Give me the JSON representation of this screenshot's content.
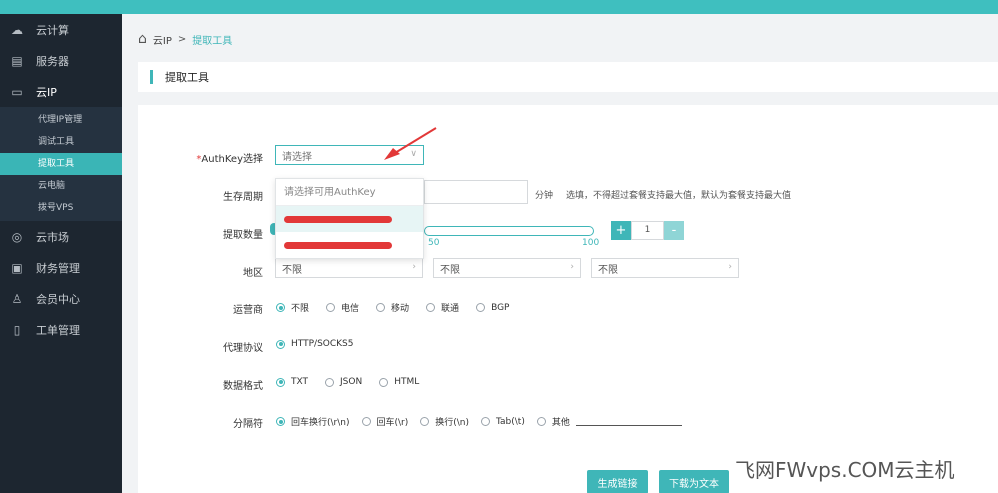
{
  "sidebar": {
    "items": [
      {
        "icon": "cloud-icon",
        "label": "云计算"
      },
      {
        "icon": "server-icon",
        "label": "服务器"
      },
      {
        "icon": "monitor-icon",
        "label": "云IP"
      }
    ],
    "sub_items": [
      {
        "label": "代理IP管理"
      },
      {
        "label": "调试工具"
      },
      {
        "label": "提取工具"
      },
      {
        "label": "云电脑"
      },
      {
        "label": "拨号VPS"
      }
    ],
    "bottom_items": [
      {
        "icon": "globe-icon",
        "label": "云市场"
      },
      {
        "icon": "finance-icon",
        "label": "财务管理"
      },
      {
        "icon": "user-icon",
        "label": "会员中心"
      },
      {
        "icon": "document-icon",
        "label": "工单管理"
      }
    ]
  },
  "breadcrumb": {
    "root": "云IP",
    "sep": ">",
    "current": "提取工具"
  },
  "page_title": "提取工具",
  "form": {
    "authkey": {
      "required_mark": "*",
      "label": "AuthKey选择",
      "placeholder": "请选择",
      "dropdown_placeholder": "请选择可用AuthKey"
    },
    "lifetime": {
      "label": "生存周期",
      "unit": "分钟",
      "hint": "选填，不得超过套餐支持最大值，默认为套餐支持最大值"
    },
    "quantity": {
      "label": "提取数量",
      "tick_mid": "50",
      "tick_max": "100",
      "stepper_value": "1",
      "plus": "+",
      "minus": "-"
    },
    "region": {
      "label": "地区",
      "selects": [
        "不限",
        "不限",
        "不限"
      ]
    },
    "isp": {
      "label": "运营商",
      "options": [
        "不限",
        "电信",
        "移动",
        "联通",
        "BGP"
      ],
      "selected": 0
    },
    "protocol": {
      "label": "代理协议",
      "options": [
        "HTTP/SOCKS5"
      ],
      "selected": 0
    },
    "format": {
      "label": "数据格式",
      "options": [
        "TXT",
        "JSON",
        "HTML"
      ],
      "selected": 0
    },
    "separator": {
      "label": "分隔符",
      "options": [
        "回车换行(\\r\\n)",
        "回车(\\r)",
        "换行(\\n)",
        "Tab(\\t)",
        "其他"
      ],
      "selected": 0
    }
  },
  "buttons": {
    "generate": "生成链接",
    "download": "下载为文本"
  },
  "watermark": "飞网FWvps.COM云主机",
  "colors": {
    "accent": "#3fb6b8",
    "sidebar_bg": "#1d2630",
    "annotation_red": "#e23838"
  }
}
